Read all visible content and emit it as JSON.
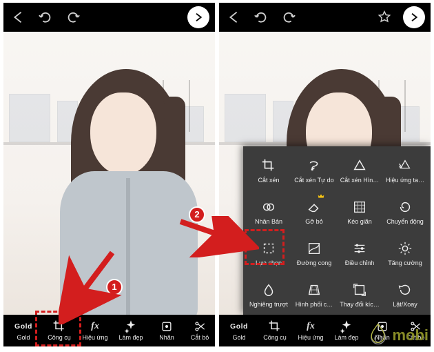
{
  "watermark": {
    "text": "mobi"
  },
  "callouts": {
    "c1": "1",
    "c2": "2"
  },
  "left": {
    "bottom": [
      {
        "name": "gold",
        "label": "Gold",
        "icon": "gold"
      },
      {
        "name": "tools",
        "label": "Công cụ",
        "icon": "crop"
      },
      {
        "name": "fx",
        "label": "Hiệu ứng",
        "icon": "fx"
      },
      {
        "name": "beauty",
        "label": "Làm đẹp",
        "icon": "sparkle"
      },
      {
        "name": "sticker",
        "label": "Nhãn",
        "icon": "tag"
      },
      {
        "name": "cutout",
        "label": "Cắt bỏ",
        "icon": "scissors"
      }
    ]
  },
  "right": {
    "bottom": [
      {
        "name": "gold",
        "label": "Gold",
        "icon": "gold"
      },
      {
        "name": "tools",
        "label": "Công cụ",
        "icon": "crop"
      },
      {
        "name": "fx",
        "label": "Hiệu ứng",
        "icon": "fx"
      },
      {
        "name": "beauty",
        "label": "Làm đẹp",
        "icon": "sparkle"
      },
      {
        "name": "sticker",
        "label": "Nhãn",
        "icon": "tag"
      },
      {
        "name": "cutout",
        "label": "Cắt bỏ",
        "icon": "scissors"
      }
    ],
    "panel": [
      {
        "name": "crop",
        "label": "Cắt xén",
        "icon": "crop"
      },
      {
        "name": "crop-free",
        "label": "Cắt xén Tự do",
        "icon": "lasso"
      },
      {
        "name": "crop-shape",
        "label": "Cắt xén Hìn…",
        "icon": "shape"
      },
      {
        "name": "fx-motion",
        "label": "Hiệu ứng ta…",
        "icon": "motion"
      },
      {
        "name": "clone",
        "label": "Nhân Bản",
        "icon": "clone"
      },
      {
        "name": "remove",
        "label": "Gỡ bỏ",
        "icon": "eraser",
        "premium": true
      },
      {
        "name": "stretch",
        "label": "Kéo giãn",
        "icon": "grid"
      },
      {
        "name": "motion",
        "label": "Chuyển động",
        "icon": "swirl"
      },
      {
        "name": "selection",
        "label": "Lựa chọn",
        "icon": "marquee"
      },
      {
        "name": "curves",
        "label": "Đường cong",
        "icon": "curves"
      },
      {
        "name": "adjust",
        "label": "Điều chỉnh",
        "icon": "sliders"
      },
      {
        "name": "enhance",
        "label": "Tăng cường",
        "icon": "sun"
      },
      {
        "name": "tilt",
        "label": "Nghiêng trượt",
        "icon": "teardrop"
      },
      {
        "name": "perspective",
        "label": "Hình phối c…",
        "icon": "perspective"
      },
      {
        "name": "resize",
        "label": "Thay đổi kíc…",
        "icon": "resize"
      },
      {
        "name": "rotate",
        "label": "Lật/Xoay",
        "icon": "rotate"
      }
    ]
  }
}
